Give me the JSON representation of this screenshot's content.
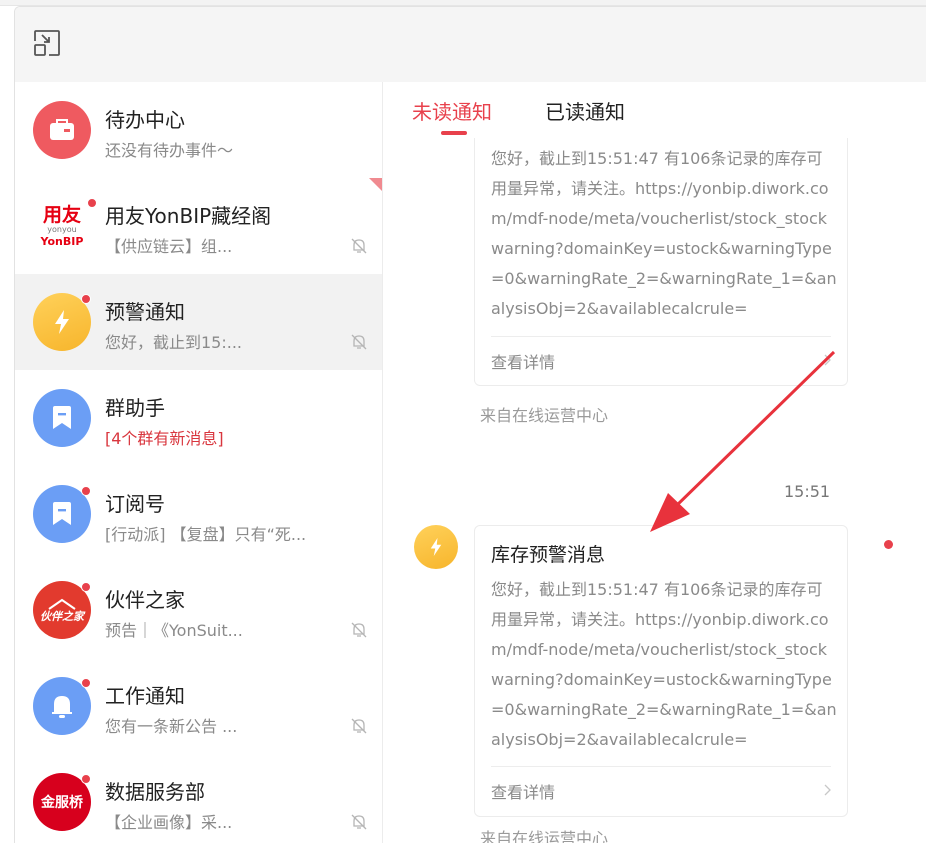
{
  "sidebar": {
    "items": [
      {
        "title": "待办中心",
        "preview": "还没有待办事件～"
      },
      {
        "title": "用友YonBIP藏经阁",
        "preview": "【供应链云】组...",
        "logo_top": "用友",
        "logo_mid": "yonyou",
        "logo_bottom": "YonBIP"
      },
      {
        "title": "预警通知",
        "preview": "您好，截止到15:..."
      },
      {
        "title": "群助手",
        "preview": "[4个群有新消息]"
      },
      {
        "title": "订阅号",
        "preview": "[行动派] 【复盘】只有“死..."
      },
      {
        "title": "伙伴之家",
        "preview": "预告｜《YonSuit...",
        "logo_text": "伙伴之家"
      },
      {
        "title": "工作通知",
        "preview": "您有一条新公告 ..."
      },
      {
        "title": "数据服务部",
        "preview": "【企业画像】采...",
        "logo_text": "金服桥"
      }
    ]
  },
  "tabs": {
    "unread": "未读通知",
    "read": "已读通知"
  },
  "messages": [
    {
      "body": "您好，截止到15:51:47 有106条记录的库存可用量异常，请关注。https://yonbip.diwork.com/mdf-node/meta/voucherlist/stock_stockwarning?domainKey=ustock&warningType=0&warningRate_2=&warningRate_1=&analysisObj=2&availablecalcrule=",
      "details": "查看详情",
      "source": "来自在线运营中心"
    },
    {
      "time": "15:51",
      "title": "库存预警消息",
      "body": "您好，截止到15:51:47 有106条记录的库存可用量异常，请关注。https://yonbip.diwork.com/mdf-node/meta/voucherlist/stock_stockwarning?domainKey=ustock&warningType=0&warningRate_2=&warningRate_1=&analysisObj=2&availablecalcrule=",
      "details": "查看详情",
      "source": "来自在线运营中心"
    }
  ],
  "colors": {
    "accent": "#e8414c",
    "annotation_arrow": "#e8323c"
  }
}
